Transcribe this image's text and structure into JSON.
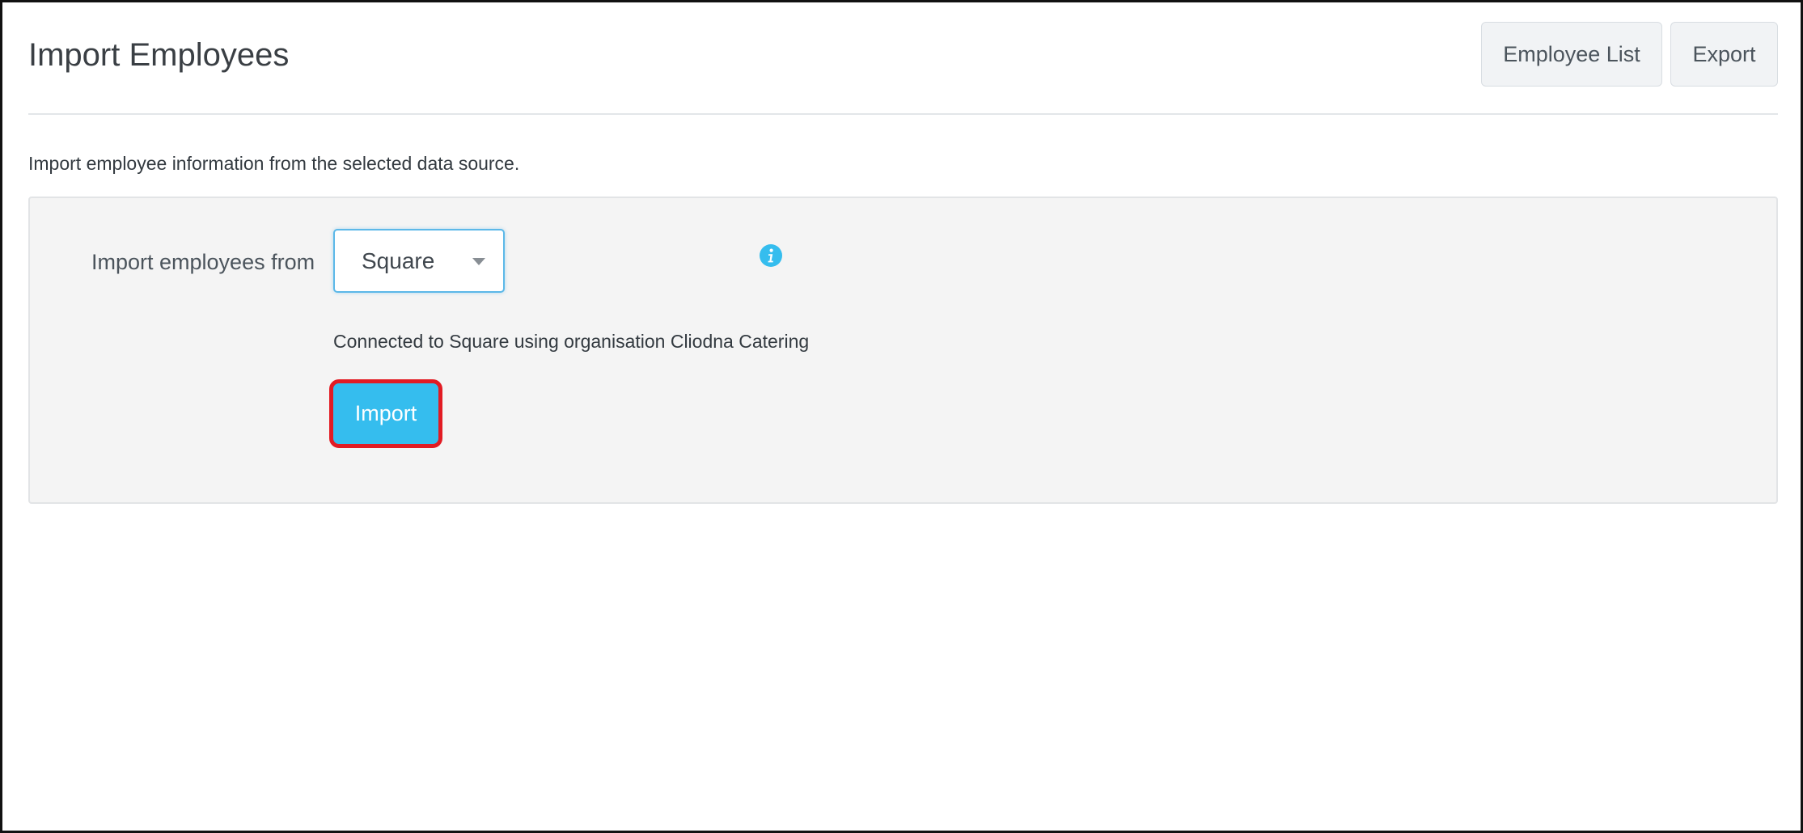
{
  "header": {
    "title": "Import Employees",
    "buttons": {
      "employee_list": "Employee List",
      "export": "Export"
    }
  },
  "main": {
    "description": "Import employee information from the selected data source.",
    "import_form": {
      "source_label": "Import employees from",
      "source_selected": "Square",
      "connection_status": "Connected to Square using organisation Cliodna Catering",
      "import_button": "Import"
    }
  },
  "icons": {
    "source_dropdown": "chevron-down-icon",
    "help": "info-icon"
  },
  "colors": {
    "accent": "#35bdee",
    "highlight_border": "#e21b23",
    "panel_background": "#f4f4f4"
  }
}
